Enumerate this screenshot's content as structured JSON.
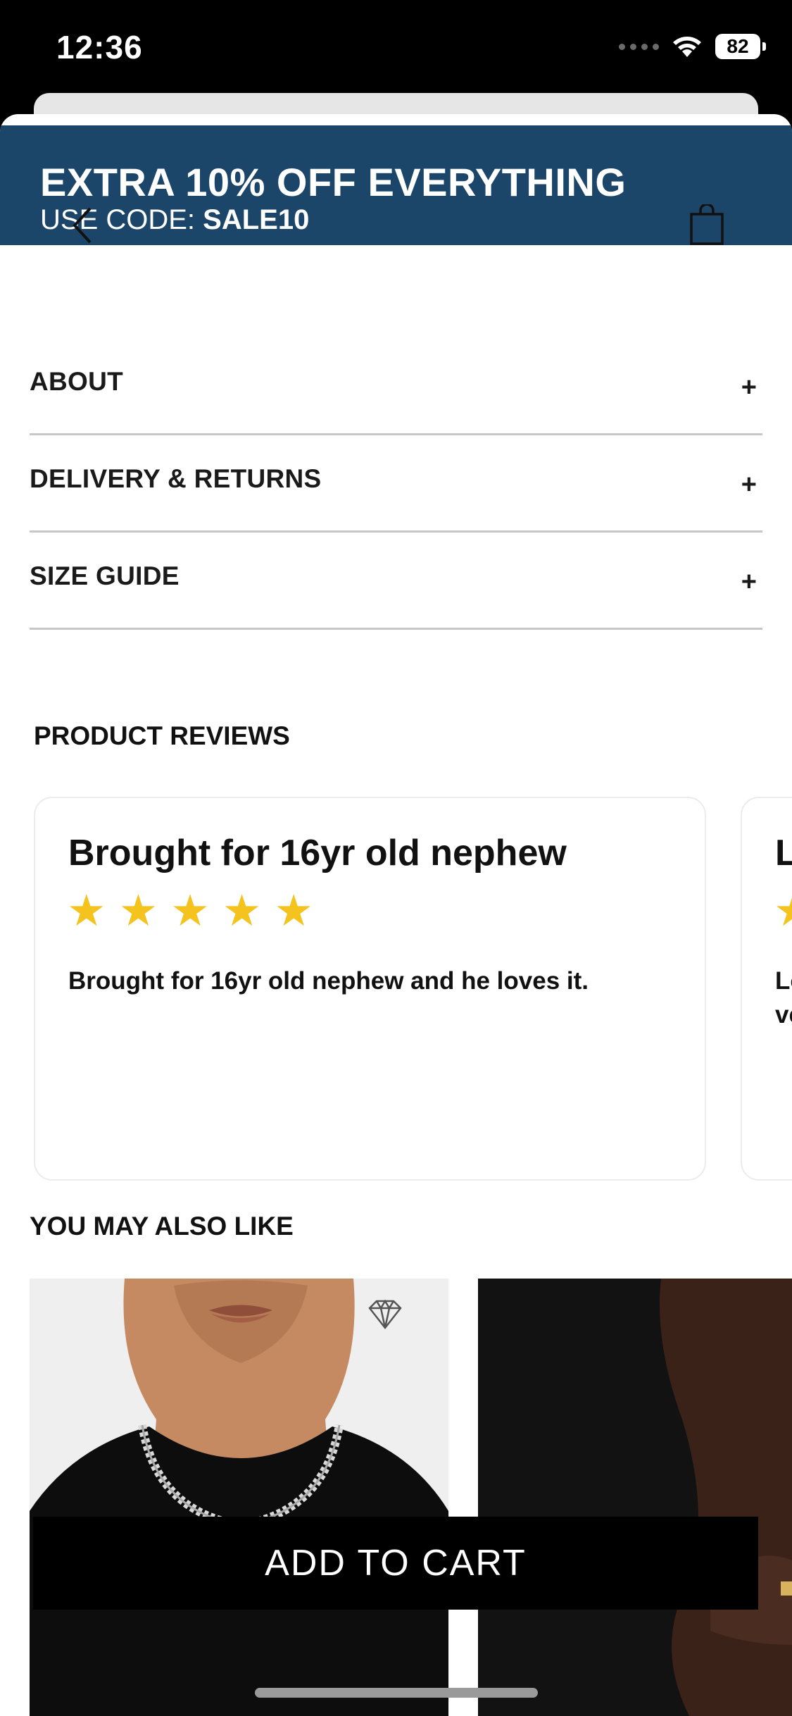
{
  "status_bar": {
    "time": "12:36",
    "battery": "82"
  },
  "promo": {
    "title": "EXTRA 10% OFF EVERYTHING",
    "code_prefix": "USE CODE: ",
    "code": "SALE10"
  },
  "nav": {
    "back_icon": "chevron-left-icon",
    "bag_icon": "shopping-bag-icon"
  },
  "accordion": [
    {
      "label": "ABOUT",
      "toggle": "+"
    },
    {
      "label": "DELIVERY & RETURNS",
      "toggle": "+"
    },
    {
      "label": "SIZE GUIDE",
      "toggle": "+"
    }
  ],
  "reviews": {
    "title": "PRODUCT REVIEWS",
    "items": [
      {
        "title": "Brought for 16yr old nephew",
        "rating": 5,
        "body": "Brought for 16yr old nephew and he loves it."
      },
      {
        "title": "L",
        "rating": 5,
        "body": "Lo\nve"
      }
    ],
    "star_color": "#f4c31d"
  },
  "you_may_also_like": {
    "title": "YOU MAY ALSO LIKE"
  },
  "cta": {
    "add_to_cart": "ADD TO CART"
  },
  "colors": {
    "promo_bg": "#1b4669",
    "cta_bg": "#000000"
  }
}
